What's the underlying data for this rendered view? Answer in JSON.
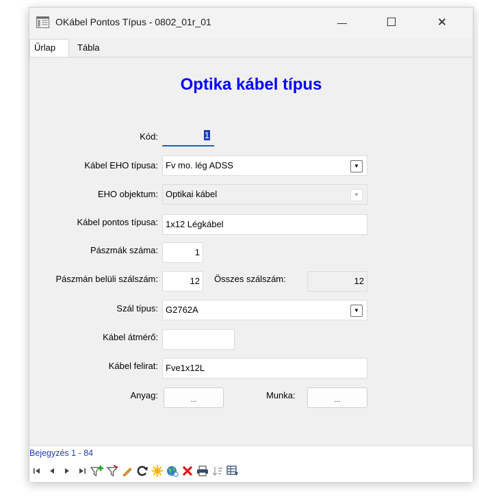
{
  "window": {
    "title": "OKábel Pontos Típus - 0802_01r_01",
    "minimize_glyph": "—",
    "maximize_glyph": "☐",
    "close_glyph": "✕"
  },
  "tabs": [
    {
      "label": "Űrlap",
      "active": true
    },
    {
      "label": "Tábla",
      "active": false
    }
  ],
  "form": {
    "title": "Optika kábel típus",
    "kod": {
      "label": "Kód:",
      "value": "1"
    },
    "kabel_eho_tipusa": {
      "label": "Kábel EHO típusa:",
      "value": "Fv mo. lég ADSS"
    },
    "eho_objektum": {
      "label": "EHO objektum:",
      "value": "Optikai kábel"
    },
    "kabel_pontos_tipusa": {
      "label": "Kábel pontos típusa:",
      "value": "1x12 Légkábel"
    },
    "pasmak_szama": {
      "label": "Pászmák száma:",
      "value": "1"
    },
    "pasman_beluli": {
      "label": "Pászmán belüli szálszám:",
      "value": "12"
    },
    "osszes_szalszam": {
      "label": "Összes szálszám:",
      "value": "12"
    },
    "szal_tipus": {
      "label": "Szál típus:",
      "value": "G2762A"
    },
    "kabel_atmero": {
      "label": "Kábel átmérő:",
      "value": ""
    },
    "kabel_felirat": {
      "label": "Kábel felirat:",
      "value": "Fve1x12L"
    },
    "anyag": {
      "label": "Anyag:",
      "button": "..."
    },
    "munka": {
      "label": "Munka:",
      "button": "..."
    }
  },
  "status": {
    "record_text": "Bejegyzés 1 - 84"
  },
  "colors": {
    "title_blue": "#0000ff",
    "record_blue": "#1f3bb8"
  },
  "nav_icons": [
    "first-record-icon",
    "prev-record-icon",
    "next-record-icon",
    "last-record-icon",
    "add-filter-icon",
    "clear-filter-icon",
    "edit-icon",
    "refresh-icon",
    "new-record-icon",
    "globe-icon",
    "delete-icon",
    "print-icon",
    "sort-icon",
    "table-view-icon"
  ]
}
